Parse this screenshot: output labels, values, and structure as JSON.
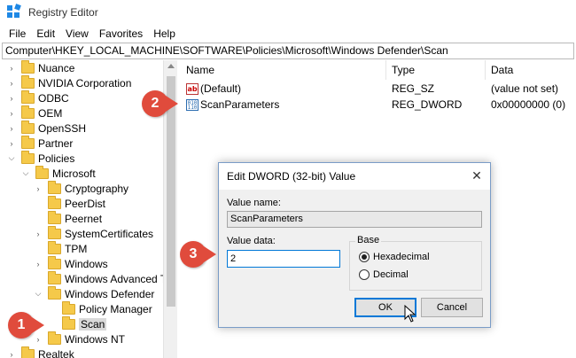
{
  "window": {
    "title": "Registry Editor"
  },
  "menu": [
    "File",
    "Edit",
    "View",
    "Favorites",
    "Help"
  ],
  "address": "Computer\\HKEY_LOCAL_MACHINE\\SOFTWARE\\Policies\\Microsoft\\Windows Defender\\Scan",
  "tree": [
    {
      "label": "Nuance"
    },
    {
      "label": "NVIDIA Corporation"
    },
    {
      "label": "ODBC"
    },
    {
      "label": "OEM"
    },
    {
      "label": "OpenSSH"
    },
    {
      "label": "Partner"
    },
    {
      "label": "Policies"
    },
    {
      "label": "Microsoft"
    },
    {
      "label": "Cryptography"
    },
    {
      "label": "PeerDist"
    },
    {
      "label": "Peernet"
    },
    {
      "label": "SystemCertificates"
    },
    {
      "label": "TPM"
    },
    {
      "label": "Windows"
    },
    {
      "label": "Windows Advanced Th"
    },
    {
      "label": "Windows Defender"
    },
    {
      "label": "Policy Manager"
    },
    {
      "label": "Scan"
    },
    {
      "label": "Windows NT"
    },
    {
      "label": "Realtek"
    }
  ],
  "list": {
    "headers": {
      "name": "Name",
      "type": "Type",
      "data": "Data"
    },
    "rows": [
      {
        "name": "(Default)",
        "type": "REG_SZ",
        "data": "(value not set)",
        "icon": "string-value-icon"
      },
      {
        "name": "ScanParameters",
        "type": "REG_DWORD",
        "data": "0x00000000 (0)",
        "icon": "binary-value-icon"
      }
    ]
  },
  "callouts": [
    "1",
    "2",
    "3"
  ],
  "dialog": {
    "title": "Edit DWORD (32-bit) Value",
    "value_name_label": "Value name:",
    "value_name": "ScanParameters",
    "value_data_label": "Value data:",
    "value_data": "2",
    "base_label": "Base",
    "base_options": [
      "Hexadecimal",
      "Decimal"
    ],
    "base_selected": "Hexadecimal",
    "ok": "OK",
    "cancel": "Cancel"
  },
  "colors": {
    "callout": "#e04b3c",
    "accent": "#0078d7",
    "folder": "#f5c94a"
  }
}
